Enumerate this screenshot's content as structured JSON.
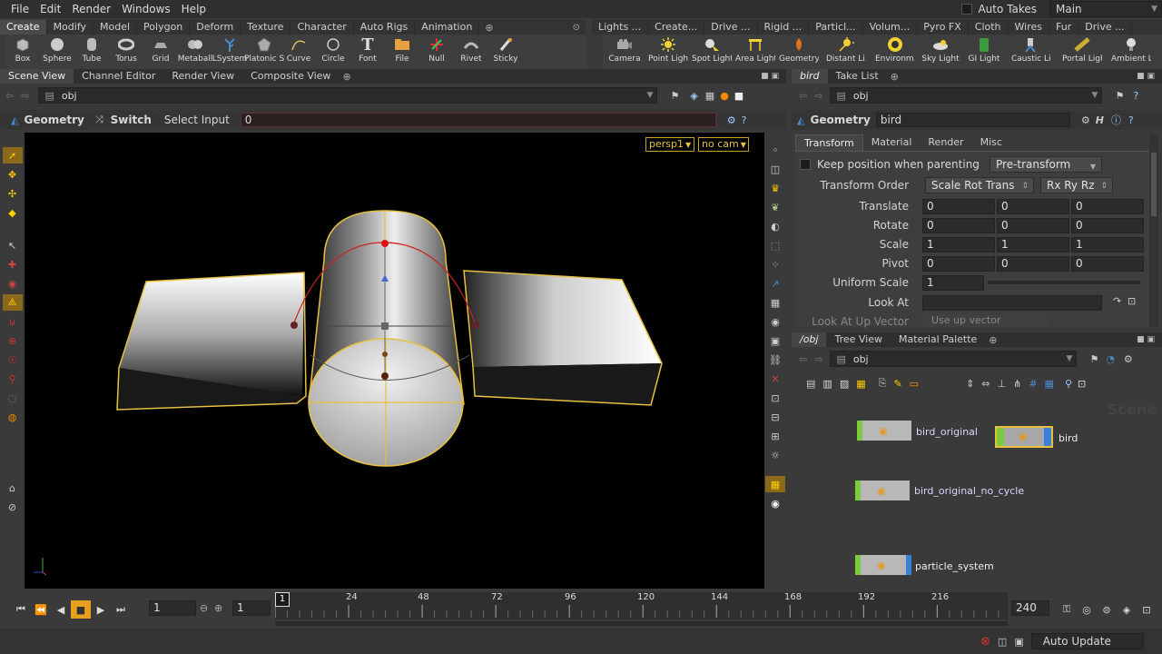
{
  "menu": [
    "File",
    "Edit",
    "Render",
    "Windows",
    "Help"
  ],
  "topright": {
    "auto_takes": "Auto Takes",
    "desktop": "Main"
  },
  "shelf_left": {
    "tabs": [
      "Create",
      "Modify",
      "Model",
      "Polygon",
      "Deform",
      "Texture",
      "Character",
      "Auto Rigs",
      "Animation"
    ],
    "tools": [
      "Box",
      "Sphere",
      "Tube",
      "Torus",
      "Grid",
      "Metaball",
      "LSystem",
      "Platonic S...",
      "Curve",
      "Circle",
      "Font",
      "File",
      "Null",
      "Rivet",
      "Sticky"
    ]
  },
  "shelf_right": {
    "tabs": [
      "Lights ...",
      "Create...",
      "Drive ...",
      "Rigid ...",
      "Particl...",
      "Volum...",
      "Pyro FX",
      "Cloth",
      "Wires",
      "Fur",
      "Drive ..."
    ],
    "tools": [
      "Camera",
      "Point Light",
      "Spot Light",
      "Area Light",
      "Geometry...",
      "Distant Li...",
      "Environm...",
      "Sky Light",
      "GI Light",
      "Caustic Li...",
      "Portal Light",
      "Ambient L"
    ]
  },
  "left_pane": {
    "tabs": [
      "Scene View",
      "Channel Editor",
      "Render View",
      "Composite View"
    ],
    "path": "obj",
    "op_type": "Geometry",
    "switch_label": "Switch",
    "select_input_label": "Select Input",
    "select_input_value": "0",
    "camera_menu": "persp1",
    "cam_menu": "no cam"
  },
  "param_pane": {
    "tabs": [
      "bird",
      "Take List"
    ],
    "path": "obj",
    "op_type": "Geometry",
    "node_name": "bird",
    "subtabs": [
      "Transform",
      "Material",
      "Render",
      "Misc"
    ],
    "keep_position": "Keep position when parenting",
    "pretransform": "Pre-transform",
    "transform_order_label": "Transform Order",
    "transform_order": "Scale Rot Trans",
    "rot_order": "Rx Ry Rz",
    "rows": [
      {
        "label": "Translate",
        "v": [
          "0",
          "0",
          "0"
        ]
      },
      {
        "label": "Rotate",
        "v": [
          "0",
          "0",
          "0"
        ]
      },
      {
        "label": "Scale",
        "v": [
          "1",
          "1",
          "1"
        ]
      },
      {
        "label": "Pivot",
        "v": [
          "0",
          "0",
          "0"
        ]
      }
    ],
    "uniform_scale_label": "Uniform Scale",
    "uniform_scale": "1",
    "look_at_label": "Look At",
    "look_at_up_label": "Look At Up Vector",
    "look_at_up_value": "Use up vector"
  },
  "network_pane": {
    "tabs": [
      "/obj",
      "Tree View",
      "Material Palette"
    ],
    "path": "obj",
    "watermark": "Scene",
    "nodes": [
      "bird_original",
      "bird",
      "bird_original_no_cycle",
      "particle_system"
    ]
  },
  "timeline": {
    "frame": "1",
    "step": "1",
    "start_marker": "1",
    "ticks": [
      "24",
      "48",
      "72",
      "96",
      "120",
      "144",
      "168",
      "192",
      "216"
    ],
    "end": "240"
  },
  "status": {
    "auto_update": "Auto Update"
  },
  "colors": {
    "accent": "#f0c030",
    "selection": "#e8c040",
    "node_green": "#7ccb3c",
    "node_blue": "#3a7fd8"
  }
}
